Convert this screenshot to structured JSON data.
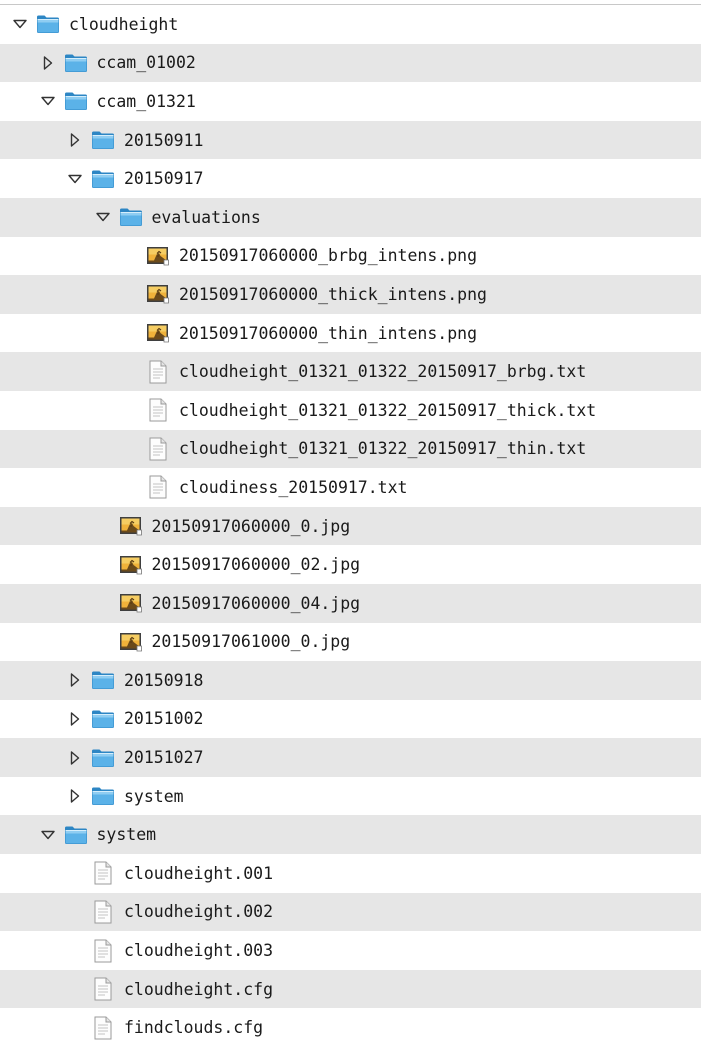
{
  "tree": {
    "rows": [
      {
        "label": "cloudheight",
        "type": "folder",
        "depth": 0,
        "expanded": true
      },
      {
        "label": "ccam_01002",
        "type": "folder",
        "depth": 1,
        "expanded": false
      },
      {
        "label": "ccam_01321",
        "type": "folder",
        "depth": 1,
        "expanded": true
      },
      {
        "label": "20150911",
        "type": "folder",
        "depth": 2,
        "expanded": false
      },
      {
        "label": "20150917",
        "type": "folder",
        "depth": 2,
        "expanded": true
      },
      {
        "label": "evaluations",
        "type": "folder",
        "depth": 3,
        "expanded": true
      },
      {
        "label": "20150917060000_brbg_intens.png",
        "type": "image",
        "depth": 4
      },
      {
        "label": "20150917060000_thick_intens.png",
        "type": "image",
        "depth": 4
      },
      {
        "label": "20150917060000_thin_intens.png",
        "type": "image",
        "depth": 4
      },
      {
        "label": "cloudheight_01321_01322_20150917_brbg.txt",
        "type": "text",
        "depth": 4
      },
      {
        "label": "cloudheight_01321_01322_20150917_thick.txt",
        "type": "text",
        "depth": 4
      },
      {
        "label": "cloudheight_01321_01322_20150917_thin.txt",
        "type": "text",
        "depth": 4
      },
      {
        "label": "cloudiness_20150917.txt",
        "type": "text",
        "depth": 4
      },
      {
        "label": "20150917060000_0.jpg",
        "type": "image",
        "depth": 3
      },
      {
        "label": "20150917060000_02.jpg",
        "type": "image",
        "depth": 3
      },
      {
        "label": "20150917060000_04.jpg",
        "type": "image",
        "depth": 3
      },
      {
        "label": "20150917061000_0.jpg",
        "type": "image",
        "depth": 3
      },
      {
        "label": "20150918",
        "type": "folder",
        "depth": 2,
        "expanded": false
      },
      {
        "label": "20151002",
        "type": "folder",
        "depth": 2,
        "expanded": false
      },
      {
        "label": "20151027",
        "type": "folder",
        "depth": 2,
        "expanded": false
      },
      {
        "label": "system",
        "type": "folder",
        "depth": 2,
        "expanded": false
      },
      {
        "label": "system",
        "type": "folder",
        "depth": 1,
        "expanded": true
      },
      {
        "label": "cloudheight.001",
        "type": "text",
        "depth": 2
      },
      {
        "label": "cloudheight.002",
        "type": "text",
        "depth": 2
      },
      {
        "label": "cloudheight.003",
        "type": "text",
        "depth": 2
      },
      {
        "label": "cloudheight.cfg",
        "type": "text",
        "depth": 2
      },
      {
        "label": "findclouds.cfg",
        "type": "text",
        "depth": 2
      }
    ]
  },
  "colors": {
    "alt_row": "#e6e6e6",
    "folder_body": "#4aa3df",
    "folder_tab": "#2d86c4",
    "arrow": "#333333"
  },
  "icons": {
    "folder": "folder-icon",
    "image": "image-file-icon",
    "text": "text-file-icon",
    "expanded": "triangle-down-icon",
    "collapsed": "triangle-right-icon"
  }
}
